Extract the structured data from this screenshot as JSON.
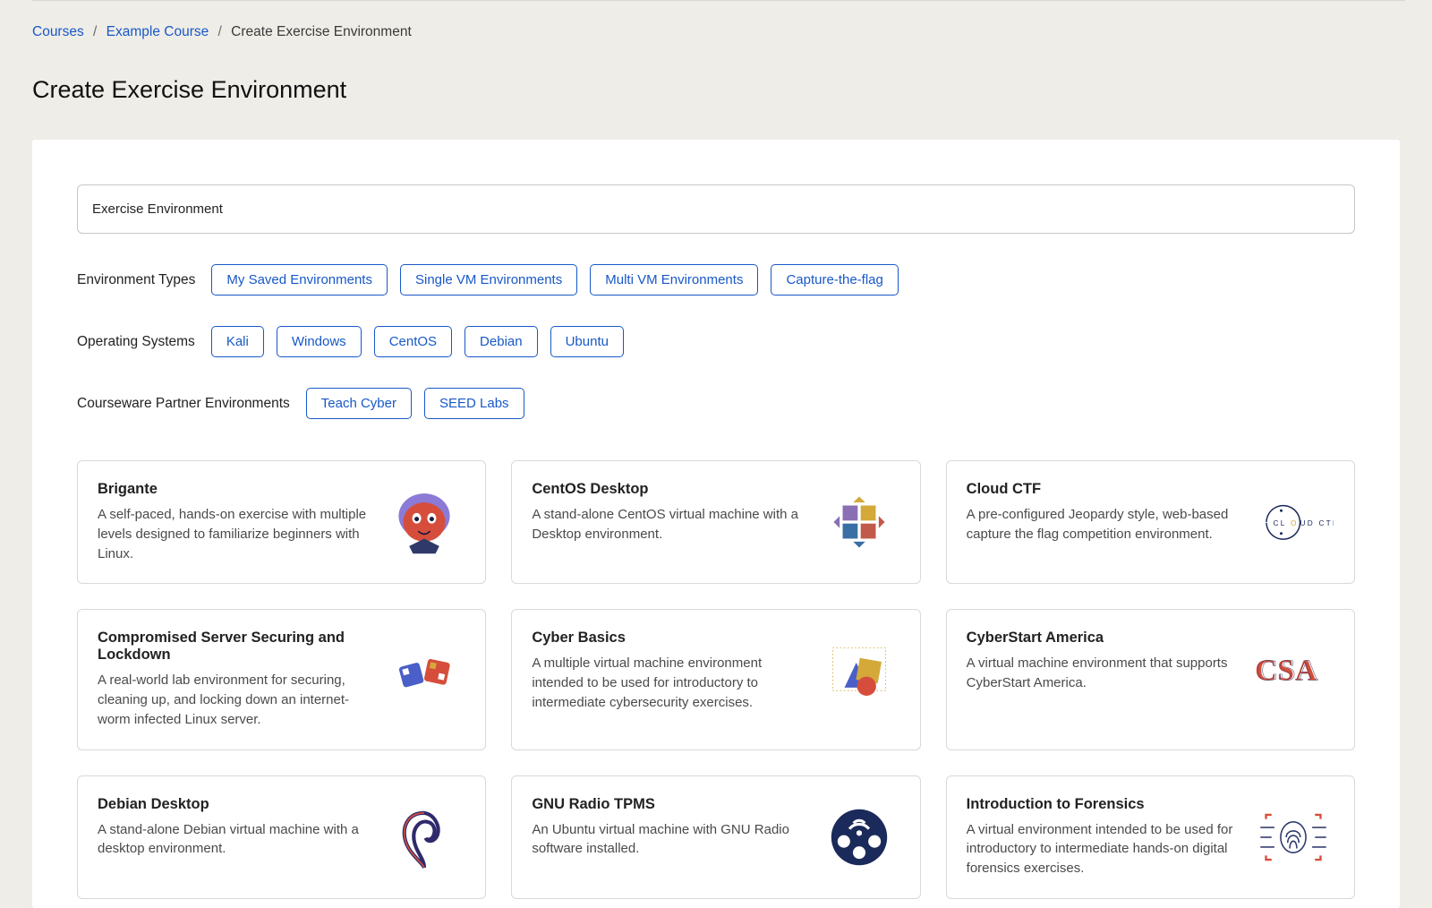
{
  "breadcrumb": {
    "items": [
      {
        "label": "Courses",
        "link": true
      },
      {
        "label": "Example Course",
        "link": true
      },
      {
        "label": "Create Exercise Environment",
        "link": false
      }
    ]
  },
  "page_title": "Create Exercise Environment",
  "name_input": {
    "value": "Exercise Environment"
  },
  "filters": {
    "env_types": {
      "label": "Environment Types",
      "options": [
        "My Saved Environments",
        "Single VM Environments",
        "Multi VM Environments",
        "Capture-the-flag"
      ]
    },
    "os": {
      "label": "Operating Systems",
      "options": [
        "Kali",
        "Windows",
        "CentOS",
        "Debian",
        "Ubuntu"
      ]
    },
    "partner": {
      "label": "Courseware Partner Environments",
      "options": [
        "Teach Cyber",
        "SEED Labs"
      ]
    }
  },
  "cards": [
    {
      "title": "Brigante",
      "desc": "A self-paced, hands-on exercise with multiple levels designed to familiarize beginners with Linux.",
      "icon": "brigante"
    },
    {
      "title": "CentOS Desktop",
      "desc": "A stand-alone CentOS virtual machine with a Desktop environment.",
      "icon": "centos"
    },
    {
      "title": "Cloud CTF",
      "desc": "A pre-configured Jeopardy style, web-based capture the flag competition environment.",
      "icon": "cloudctf"
    },
    {
      "title": "Compromised Server Securing and Lockdown",
      "desc": "A real-world lab environment for securing, cleaning up, and locking down an internet-worm infected Linux server.",
      "icon": "compromised"
    },
    {
      "title": "Cyber Basics",
      "desc": "A multiple virtual machine environment intended to be used for introductory to intermediate cybersecurity exercises.",
      "icon": "cyberbasics"
    },
    {
      "title": "CyberStart America",
      "desc": "A virtual machine environment that supports CyberStart America.",
      "icon": "csa"
    },
    {
      "title": "Debian Desktop",
      "desc": "A stand-alone Debian virtual machine with a desktop environment.",
      "icon": "debian"
    },
    {
      "title": "GNU Radio TPMS",
      "desc": "An Ubuntu virtual machine with GNU Radio software installed.",
      "icon": "gnu"
    },
    {
      "title": "Introduction to Forensics",
      "desc": "A virtual environment intended to be used for introductory to intermediate hands-on digital forensics exercises.",
      "icon": "forensics"
    }
  ]
}
